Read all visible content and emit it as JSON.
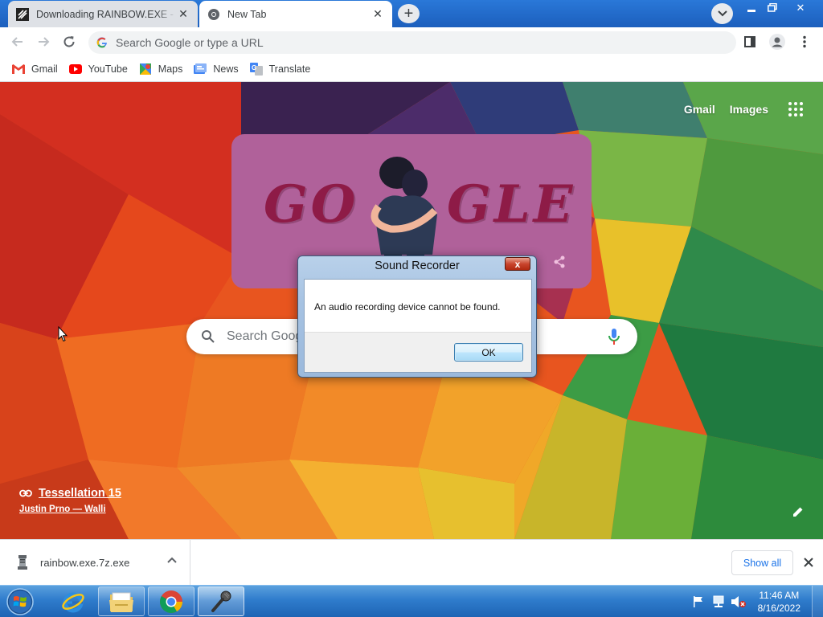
{
  "browser": {
    "tabs": [
      {
        "title": "Downloading RAINBOW.EXE - Google Chrome",
        "active": false
      },
      {
        "title": "New Tab",
        "active": true
      }
    ],
    "omnibox_placeholder": "Search Google or type a URL",
    "bookmarks": [
      {
        "label": "Gmail",
        "icon": "gmail-icon"
      },
      {
        "label": "YouTube",
        "icon": "youtube-icon"
      },
      {
        "label": "Maps",
        "icon": "maps-icon"
      },
      {
        "label": "News",
        "icon": "news-icon"
      },
      {
        "label": "Translate",
        "icon": "translate-icon"
      }
    ]
  },
  "newtab": {
    "top_links": [
      "Gmail",
      "Images"
    ],
    "doodle_letters_left": "GO",
    "doodle_letters_right": "GLE",
    "search_placeholder": "Search Google or type a URL",
    "search_placeholder_visible": "Search Goog",
    "background_title": "Tessellation 15",
    "background_author": "Justin Prno — Walli"
  },
  "dialog": {
    "title": "Sound Recorder",
    "close_label": "x",
    "message": "An audio recording device cannot be found.",
    "ok_label": "OK"
  },
  "downloads": {
    "filename": "rainbow.exe.7z.exe",
    "show_all_label": "Show all"
  },
  "taskbar": {
    "clock_time": "11:46 AM",
    "clock_date": "8/16/2022"
  },
  "colors": {
    "accent_blue": "#1a73e8",
    "doodle_bg": "#b0619a",
    "taskbar": "#2f7ccc"
  }
}
